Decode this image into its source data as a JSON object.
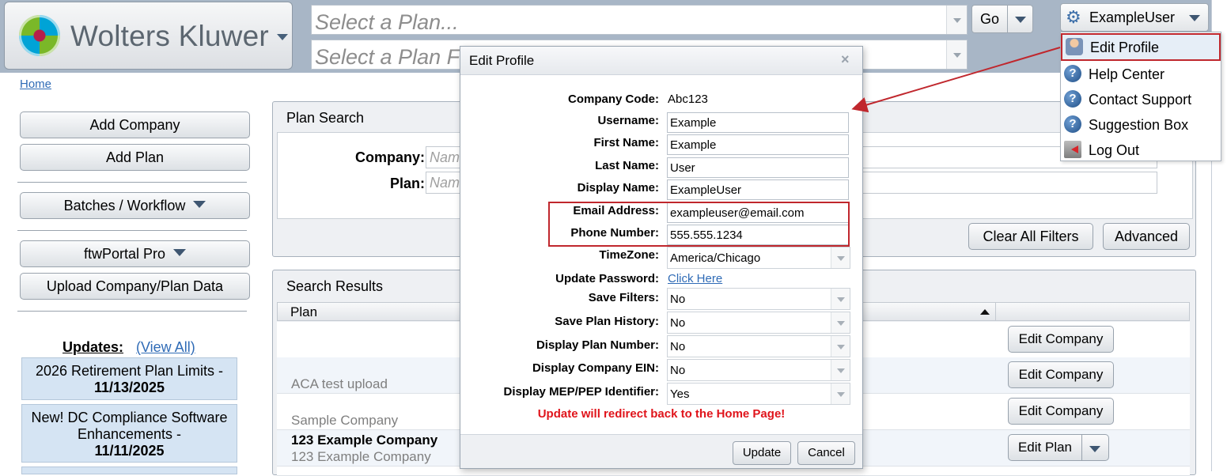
{
  "header": {
    "brand": "Wolters Kluwer",
    "plan_select_placeholder": "Select a Plan...",
    "plan_select2_placeholder": "Select a Plan F",
    "go_label": "Go",
    "user_name": "ExampleUser"
  },
  "user_menu": {
    "items": [
      {
        "label": "Edit Profile",
        "icon": "user-profile-icon"
      },
      {
        "label": "Help Center",
        "icon": "help-icon"
      },
      {
        "label": "Contact Support",
        "icon": "help-icon"
      },
      {
        "label": "Suggestion Box",
        "icon": "help-icon"
      },
      {
        "label": "Log Out",
        "icon": "logout-icon"
      }
    ]
  },
  "breadcrumb": {
    "home": "Home"
  },
  "sidebar": {
    "add_company": "Add Company",
    "add_plan": "Add Plan",
    "batches": "Batches / Workflow",
    "ftwportal": "ftwPortal Pro",
    "upload": "Upload Company/Plan Data",
    "updates_title": "Updates:",
    "updates_view_all": "(View All)",
    "updates": [
      {
        "text": "2026 Retirement Plan Limits -",
        "date": "11/13/2025"
      },
      {
        "text": "New! DC Compliance Software Enhancements -",
        "date": "11/11/2025"
      }
    ]
  },
  "plan_search": {
    "title": "Plan Search",
    "company_label": "Company:",
    "company_placeholder": "Nam",
    "plan_label": "Plan:",
    "plan_placeholder": "Nam",
    "clear_filters": "Clear All Filters",
    "advanced": "Advanced"
  },
  "search_results": {
    "title": "Search Results",
    "column_plan": "Plan",
    "rows": [
      {
        "line1": "",
        "line2": "",
        "button": "Edit Company"
      },
      {
        "line1": "",
        "line2": "ACA test upload",
        "button": "Edit Company"
      },
      {
        "line1": "",
        "line2": "Sample Company",
        "button": "Edit Company"
      },
      {
        "line1": "123 Example Company",
        "line2": "123 Example Company",
        "button": "Edit Plan"
      }
    ]
  },
  "modal": {
    "title": "Edit Profile",
    "close": "×",
    "company_code_label": "Company Code:",
    "company_code_value": "Abc123",
    "username_label": "Username:",
    "username_value": "Example",
    "first_name_label": "First Name:",
    "first_name_value": "Example",
    "last_name_label": "Last Name:",
    "last_name_value": "User",
    "display_name_label": "Display Name:",
    "display_name_value": "ExampleUser",
    "email_label": "Email Address:",
    "email_value": "exampleuser@email.com",
    "phone_label": "Phone Number:",
    "phone_value": "555.555.1234",
    "timezone_label": "TimeZone:",
    "timezone_value": "America/Chicago",
    "password_label": "Update Password:",
    "password_link": "Click Here",
    "save_filters_label": "Save Filters:",
    "save_filters_value": "No",
    "save_history_label": "Save Plan History:",
    "save_history_value": "No",
    "display_plan_number_label": "Display Plan Number:",
    "display_plan_number_value": "No",
    "display_ein_label": "Display Company EIN:",
    "display_ein_value": "No",
    "display_mep_label": "Display MEP/PEP Identifier:",
    "display_mep_value": "Yes",
    "redirect_message": "Update will redirect back to the Home Page!",
    "update_button": "Update",
    "cancel_button": "Cancel"
  },
  "colors": {
    "header_bg": "#a8b6c6",
    "highlight_red": "#c0272d",
    "warning_red": "#e0141b",
    "link_blue": "#2f6bb6",
    "update_card_bg": "#d5e4f3"
  }
}
